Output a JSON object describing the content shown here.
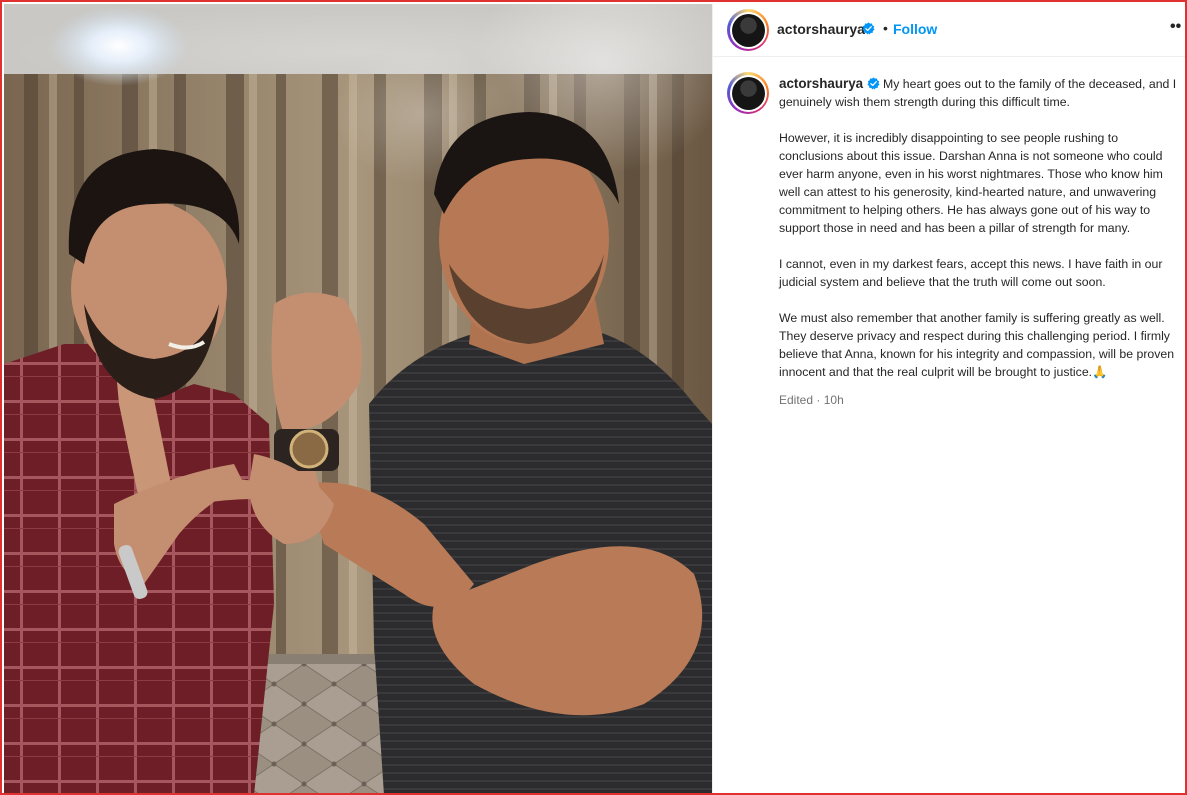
{
  "post": {
    "username": "actorshaurya",
    "separator": "•",
    "follow_label": "Follow",
    "more_label": "••"
  },
  "caption": {
    "username": "actorshaurya",
    "paragraphs": [
      "My heart goes out to the family of the deceased, and I genuinely wish them strength during this difficult time.",
      "However, it is incredibly disappointing to see people rushing to conclusions about this issue. Darshan Anna is not someone who could ever harm anyone, even in his worst nightmares. Those who know him well can attest to his generosity, kind-hearted nature, and unwavering commitment to helping others. He has always gone out of his way to support those in need and has been a pillar of strength for many.",
      "I cannot, even in my darkest fears, accept this news. I have faith in our judicial system and believe that the truth will come out soon.",
      "We must also remember that another family is suffering greatly as well. They deserve privacy and respect during this challenging period. I firmly believe that Anna, known for his integrity and compassion, will be proven innocent and that the real culprit will be brought to justice.🙏"
    ],
    "edited_label": "Edited",
    "time_ago": "10h"
  },
  "colors": {
    "accent_blue": "#0095f6",
    "text": "#262626",
    "muted": "#737373",
    "frame_border": "#e03030"
  },
  "icons": {
    "verified": "verified-badge-icon",
    "more": "more-options-icon"
  }
}
